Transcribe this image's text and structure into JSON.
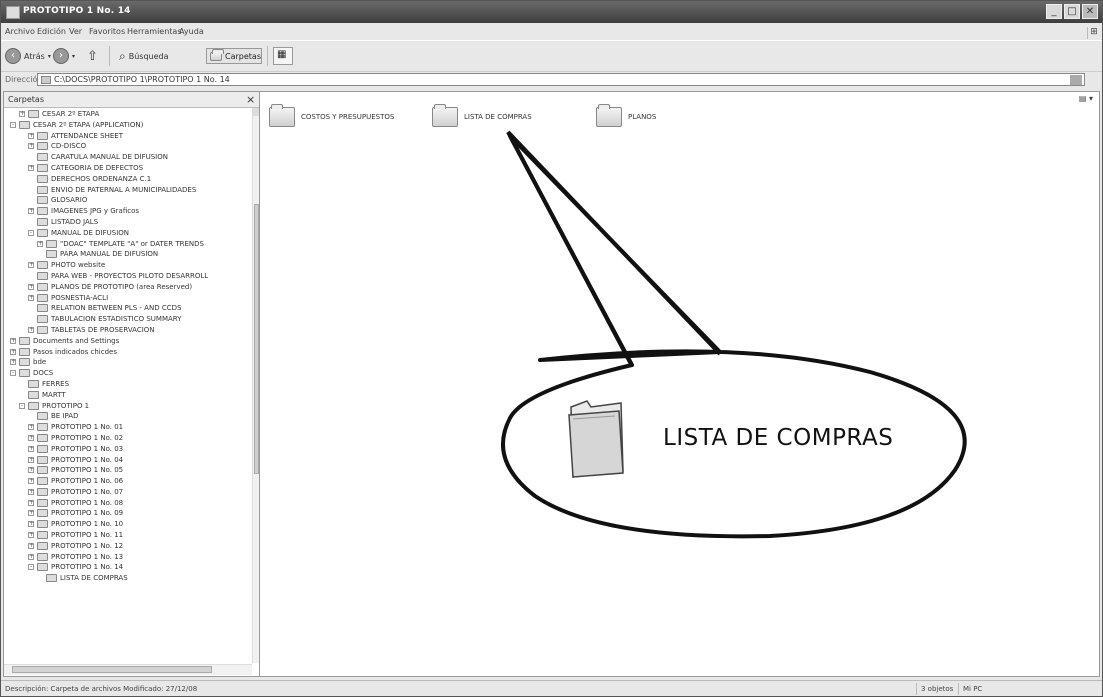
{
  "window": {
    "title": "PROTOTIPO 1 No. 14"
  },
  "menu": [
    "Archivo",
    "Edición",
    "Ver",
    "Favoritos",
    "Herramientas",
    "Ayuda"
  ],
  "toolbar": {
    "back_label": "Atrás",
    "search_label": "Búsqueda",
    "folders_label": "Carpetas"
  },
  "address": {
    "label": "Dirección",
    "path": "C:\\DOCS\\PROTOTIPO 1\\PROTOTIPO 1 No. 14"
  },
  "tree": {
    "header": "Carpetas",
    "items": [
      {
        "indent": 2,
        "exp": "+",
        "label": "CESAR 2º ETAPA"
      },
      {
        "indent": 1,
        "exp": "-",
        "label": "CESAR 2º ETAPA (APPLICATION)"
      },
      {
        "indent": 3,
        "exp": "+",
        "label": "ATTENDANCE SHEET"
      },
      {
        "indent": 3,
        "exp": "+",
        "label": "CD-DISCO"
      },
      {
        "indent": 3,
        "exp": "",
        "label": "CARATULA MANUAL DE DIFUSION"
      },
      {
        "indent": 3,
        "exp": "+",
        "label": "CATEGORIA DE DEFECTOS"
      },
      {
        "indent": 3,
        "exp": "",
        "label": "DERECHOS ORDENANZA C.1"
      },
      {
        "indent": 3,
        "exp": "",
        "label": "ENVIO DE PATERNAL A MUNICIPALIDADES"
      },
      {
        "indent": 3,
        "exp": "",
        "label": "GLOSARIO"
      },
      {
        "indent": 3,
        "exp": "+",
        "label": "IMAGENES JPG y Graficos"
      },
      {
        "indent": 3,
        "exp": "",
        "label": "LISTADO JALS"
      },
      {
        "indent": 3,
        "exp": "-",
        "label": "MANUAL DE DIFUSION"
      },
      {
        "indent": 4,
        "exp": "+",
        "label": "\"DOAC\" TEMPLATE \"A\" or DATER TRENDS"
      },
      {
        "indent": 4,
        "exp": "",
        "label": "PARA MANUAL DE DIFUSION"
      },
      {
        "indent": 3,
        "exp": "+",
        "label": "PHOTO website"
      },
      {
        "indent": 3,
        "exp": "",
        "label": "PARA WEB - PROYECTOS PILOTO DESARROLL"
      },
      {
        "indent": 3,
        "exp": "+",
        "label": "PLANOS DE PROTOTIPO (area Reserved)"
      },
      {
        "indent": 3,
        "exp": "+",
        "label": "POSNESTIA-ACLI"
      },
      {
        "indent": 3,
        "exp": "",
        "label": "RELATION BETWEEN PLS - AND CCDS"
      },
      {
        "indent": 3,
        "exp": "",
        "label": "TABULACION ESTADISTICO SUMMARY"
      },
      {
        "indent": 3,
        "exp": "+",
        "label": "TABLETAS DE PROSERVACION"
      },
      {
        "indent": 1,
        "exp": "+",
        "label": "Documents and Settings"
      },
      {
        "indent": 1,
        "exp": "+",
        "label": "Pasos indicados chicdes"
      },
      {
        "indent": 1,
        "exp": "+",
        "label": "bde"
      },
      {
        "indent": 1,
        "exp": "-",
        "label": "DOCS"
      },
      {
        "indent": 2,
        "exp": "",
        "label": "FERRES"
      },
      {
        "indent": 2,
        "exp": "",
        "label": "MARTT"
      },
      {
        "indent": 2,
        "exp": "-",
        "label": "PROTOTIPO 1"
      },
      {
        "indent": 3,
        "exp": "",
        "label": "BE IPAD"
      },
      {
        "indent": 3,
        "exp": "+",
        "label": "PROTOTIPO 1 No. 01"
      },
      {
        "indent": 3,
        "exp": "+",
        "label": "PROTOTIPO 1 No. 02"
      },
      {
        "indent": 3,
        "exp": "+",
        "label": "PROTOTIPO 1 No. 03"
      },
      {
        "indent": 3,
        "exp": "+",
        "label": "PROTOTIPO 1 No. 04"
      },
      {
        "indent": 3,
        "exp": "+",
        "label": "PROTOTIPO 1 No. 05"
      },
      {
        "indent": 3,
        "exp": "+",
        "label": "PROTOTIPO 1 No. 06"
      },
      {
        "indent": 3,
        "exp": "+",
        "label": "PROTOTIPO 1 No. 07"
      },
      {
        "indent": 3,
        "exp": "+",
        "label": "PROTOTIPO 1 No. 08"
      },
      {
        "indent": 3,
        "exp": "+",
        "label": "PROTOTIPO 1 No. 09"
      },
      {
        "indent": 3,
        "exp": "+",
        "label": "PROTOTIPO 1 No. 10"
      },
      {
        "indent": 3,
        "exp": "+",
        "label": "PROTOTIPO 1 No. 11"
      },
      {
        "indent": 3,
        "exp": "+",
        "label": "PROTOTIPO 1 No. 12"
      },
      {
        "indent": 3,
        "exp": "+",
        "label": "PROTOTIPO 1 No. 13"
      },
      {
        "indent": 3,
        "exp": "-",
        "label": "PROTOTIPO 1 No. 14"
      },
      {
        "indent": 4,
        "exp": "",
        "label": "LISTA DE COMPRAS"
      }
    ]
  },
  "folders": [
    {
      "label": "COSTOS Y PRESUPUESTOS"
    },
    {
      "label": "LISTA DE COMPRAS"
    },
    {
      "label": "PLANOS"
    }
  ],
  "callout": {
    "label": "LISTA DE COMPRAS"
  },
  "status": {
    "left": "Descripción: Carpeta de archivos  Modificado: 27/12/08",
    "mid": "3 objetos",
    "right": "Mi PC"
  }
}
